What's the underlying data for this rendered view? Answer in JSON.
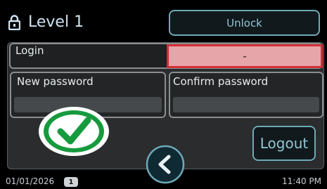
{
  "header": {
    "title": "Level 1",
    "unlock_label": "Unlock",
    "lock_icon": "lock-icon"
  },
  "login": {
    "label": "Login",
    "value": "-",
    "state_color": "#d42d35"
  },
  "passwords": {
    "new_label": "New password",
    "new_value": "",
    "confirm_label": "Confirm password",
    "confirm_value": ""
  },
  "status_icon": "check-circle-icon",
  "logout_label": "Logout",
  "back_icon": "chevron-left-icon",
  "status_bar": {
    "date": "01/01/2026",
    "badge": "1",
    "time": "11:40 PM"
  },
  "colors": {
    "accent": "#6ea9b8",
    "check_green": "#169a3e"
  }
}
